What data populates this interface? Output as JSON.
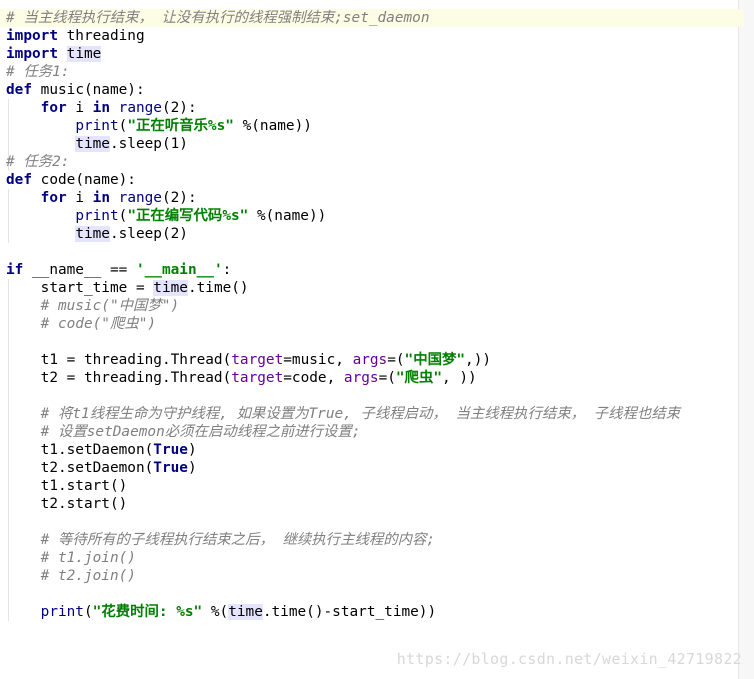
{
  "lines": [
    {
      "parts": [
        {
          "t": "# 当主线程执行结束， 让没有执行的线程强制结束;set_daemon",
          "c": "c"
        }
      ],
      "hl": true
    },
    {
      "parts": [
        {
          "t": "import",
          "c": "k"
        },
        {
          "t": " threading",
          "c": ""
        }
      ]
    },
    {
      "parts": [
        {
          "t": "import",
          "c": "k"
        },
        {
          "t": " ",
          "c": ""
        },
        {
          "t": "time",
          "c": "ref"
        }
      ]
    },
    {
      "parts": [
        {
          "t": "# 任务1:",
          "c": "c"
        }
      ]
    },
    {
      "parts": [
        {
          "t": "def",
          "c": "k"
        },
        {
          "t": " music(name):",
          "c": ""
        }
      ]
    },
    {
      "parts": [
        {
          "t": "    ",
          "c": ""
        },
        {
          "t": "for",
          "c": "k"
        },
        {
          "t": " i ",
          "c": ""
        },
        {
          "t": "in",
          "c": "k"
        },
        {
          "t": " ",
          "c": ""
        },
        {
          "t": "range",
          "c": "bi"
        },
        {
          "t": "(2):",
          "c": ""
        }
      ]
    },
    {
      "parts": [
        {
          "t": "        ",
          "c": ""
        },
        {
          "t": "print",
          "c": "bi"
        },
        {
          "t": "(",
          "c": ""
        },
        {
          "t": "\"正在听音乐%s\"",
          "c": "s"
        },
        {
          "t": " %(name))",
          "c": ""
        }
      ]
    },
    {
      "parts": [
        {
          "t": "        ",
          "c": ""
        },
        {
          "t": "time",
          "c": "ref"
        },
        {
          "t": ".sleep(1)",
          "c": ""
        }
      ]
    },
    {
      "parts": [
        {
          "t": "# 任务2:",
          "c": "c"
        }
      ]
    },
    {
      "parts": [
        {
          "t": "def",
          "c": "k"
        },
        {
          "t": " code(name):",
          "c": ""
        }
      ]
    },
    {
      "parts": [
        {
          "t": "    ",
          "c": ""
        },
        {
          "t": "for",
          "c": "k"
        },
        {
          "t": " i ",
          "c": ""
        },
        {
          "t": "in",
          "c": "k"
        },
        {
          "t": " ",
          "c": ""
        },
        {
          "t": "range",
          "c": "bi"
        },
        {
          "t": "(2):",
          "c": ""
        }
      ]
    },
    {
      "parts": [
        {
          "t": "        ",
          "c": ""
        },
        {
          "t": "print",
          "c": "bi"
        },
        {
          "t": "(",
          "c": ""
        },
        {
          "t": "\"正在编写代码%s\"",
          "c": "s"
        },
        {
          "t": " %(name))",
          "c": ""
        }
      ]
    },
    {
      "parts": [
        {
          "t": "        ",
          "c": ""
        },
        {
          "t": "time",
          "c": "ref"
        },
        {
          "t": ".sleep(2)",
          "c": ""
        }
      ]
    },
    {
      "parts": []
    },
    {
      "parts": [
        {
          "t": "if",
          "c": "k"
        },
        {
          "t": " __name__ == ",
          "c": ""
        },
        {
          "t": "'__main__'",
          "c": "s"
        },
        {
          "t": ":",
          "c": ""
        }
      ]
    },
    {
      "parts": [
        {
          "t": "    start_time = ",
          "c": ""
        },
        {
          "t": "time",
          "c": "ref"
        },
        {
          "t": ".time()",
          "c": ""
        }
      ]
    },
    {
      "parts": [
        {
          "t": "    ",
          "c": ""
        },
        {
          "t": "# music(\"中国梦\")",
          "c": "c"
        }
      ]
    },
    {
      "parts": [
        {
          "t": "    ",
          "c": ""
        },
        {
          "t": "# code(\"爬虫\")",
          "c": "c"
        }
      ]
    },
    {
      "parts": []
    },
    {
      "parts": [
        {
          "t": "    t1 = threading.Thread(",
          "c": ""
        },
        {
          "t": "target",
          "c": "kw"
        },
        {
          "t": "=music, ",
          "c": ""
        },
        {
          "t": "args",
          "c": "kw"
        },
        {
          "t": "=(",
          "c": ""
        },
        {
          "t": "\"中国梦\"",
          "c": "s"
        },
        {
          "t": ",))",
          "c": ""
        }
      ]
    },
    {
      "parts": [
        {
          "t": "    t2 = threading.Thread(",
          "c": ""
        },
        {
          "t": "target",
          "c": "kw"
        },
        {
          "t": "=code, ",
          "c": ""
        },
        {
          "t": "args",
          "c": "kw"
        },
        {
          "t": "=(",
          "c": ""
        },
        {
          "t": "\"爬虫\"",
          "c": "s"
        },
        {
          "t": ", ))",
          "c": ""
        }
      ]
    },
    {
      "parts": []
    },
    {
      "parts": [
        {
          "t": "    ",
          "c": ""
        },
        {
          "t": "# 将t1线程生命为守护线程, 如果设置为True, 子线程启动， 当主线程执行结束， 子线程也结束",
          "c": "c"
        }
      ]
    },
    {
      "parts": [
        {
          "t": "    ",
          "c": ""
        },
        {
          "t": "# 设置setDaemon必须在启动线程之前进行设置;",
          "c": "c"
        }
      ]
    },
    {
      "parts": [
        {
          "t": "    t1.setDaemon(",
          "c": ""
        },
        {
          "t": "True",
          "c": "k"
        },
        {
          "t": ")",
          "c": ""
        }
      ]
    },
    {
      "parts": [
        {
          "t": "    t2.setDaemon(",
          "c": ""
        },
        {
          "t": "True",
          "c": "k"
        },
        {
          "t": ")",
          "c": ""
        }
      ]
    },
    {
      "parts": [
        {
          "t": "    t1.start()",
          "c": ""
        }
      ]
    },
    {
      "parts": [
        {
          "t": "    t2.start()",
          "c": ""
        }
      ]
    },
    {
      "parts": []
    },
    {
      "parts": [
        {
          "t": "    ",
          "c": ""
        },
        {
          "t": "# 等待所有的子线程执行结束之后， 继续执行主线程的内容;",
          "c": "c"
        }
      ]
    },
    {
      "parts": [
        {
          "t": "    ",
          "c": ""
        },
        {
          "t": "# t1.join()",
          "c": "c"
        }
      ]
    },
    {
      "parts": [
        {
          "t": "    ",
          "c": ""
        },
        {
          "t": "# t2.join()",
          "c": "c"
        }
      ]
    },
    {
      "parts": []
    },
    {
      "parts": [
        {
          "t": "    ",
          "c": ""
        },
        {
          "t": "print",
          "c": "bi"
        },
        {
          "t": "(",
          "c": ""
        },
        {
          "t": "\"花费时间: %s\"",
          "c": "s"
        },
        {
          "t": " %(",
          "c": ""
        },
        {
          "t": "time",
          "c": "ref"
        },
        {
          "t": ".time()-start_time))",
          "c": ""
        }
      ]
    }
  ],
  "watermark": "https://blog.csdn.net/weixin_42719822",
  "colors": {
    "keyword": "#000080",
    "string": "#008000",
    "comment": "#808080",
    "keyword_arg": "#660099",
    "reference_highlight": "#e4e4ff",
    "caret_line": "#fdfde6"
  }
}
